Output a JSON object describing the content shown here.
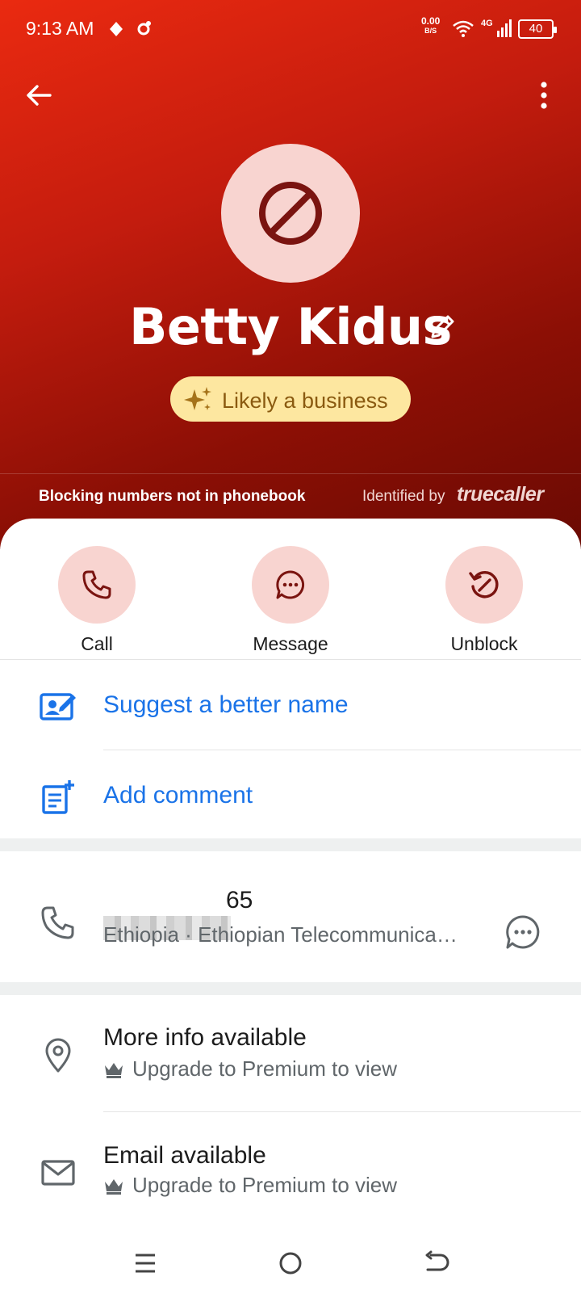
{
  "status_bar": {
    "time": "9:13 AM",
    "net_speed_value": "0.00",
    "net_speed_unit": "B/S",
    "network_type": "4G",
    "battery": "40"
  },
  "contact": {
    "name": "Betty Kidus",
    "badge": "Likely a business",
    "blocking_notice": "Blocking numbers not in phonebook",
    "identified_by": "Identified by",
    "brand": "truecaller"
  },
  "actions": [
    {
      "label": "Call",
      "icon": "phone-icon"
    },
    {
      "label": "Message",
      "icon": "chat-bubble-icon"
    },
    {
      "label": "Unblock",
      "icon": "unblock-icon"
    }
  ],
  "suggest": {
    "suggest_name": "Suggest a better name",
    "add_comment": "Add comment"
  },
  "number": {
    "visible_suffix": "65",
    "carrier": "Ethiopia · Ethiopian Telecommunica…"
  },
  "premium": {
    "more_info_title": "More info available",
    "more_info_sub": "Upgrade to Premium to view",
    "email_title": "Email available",
    "email_sub": "Upgrade to Premium to view"
  },
  "colors": {
    "header_top": "#ea2a10",
    "header_bottom": "#6a0a03",
    "accent_pink": "#f8d4d0",
    "link_blue": "#1a73e8",
    "badge_bg": "#fde7a0"
  }
}
